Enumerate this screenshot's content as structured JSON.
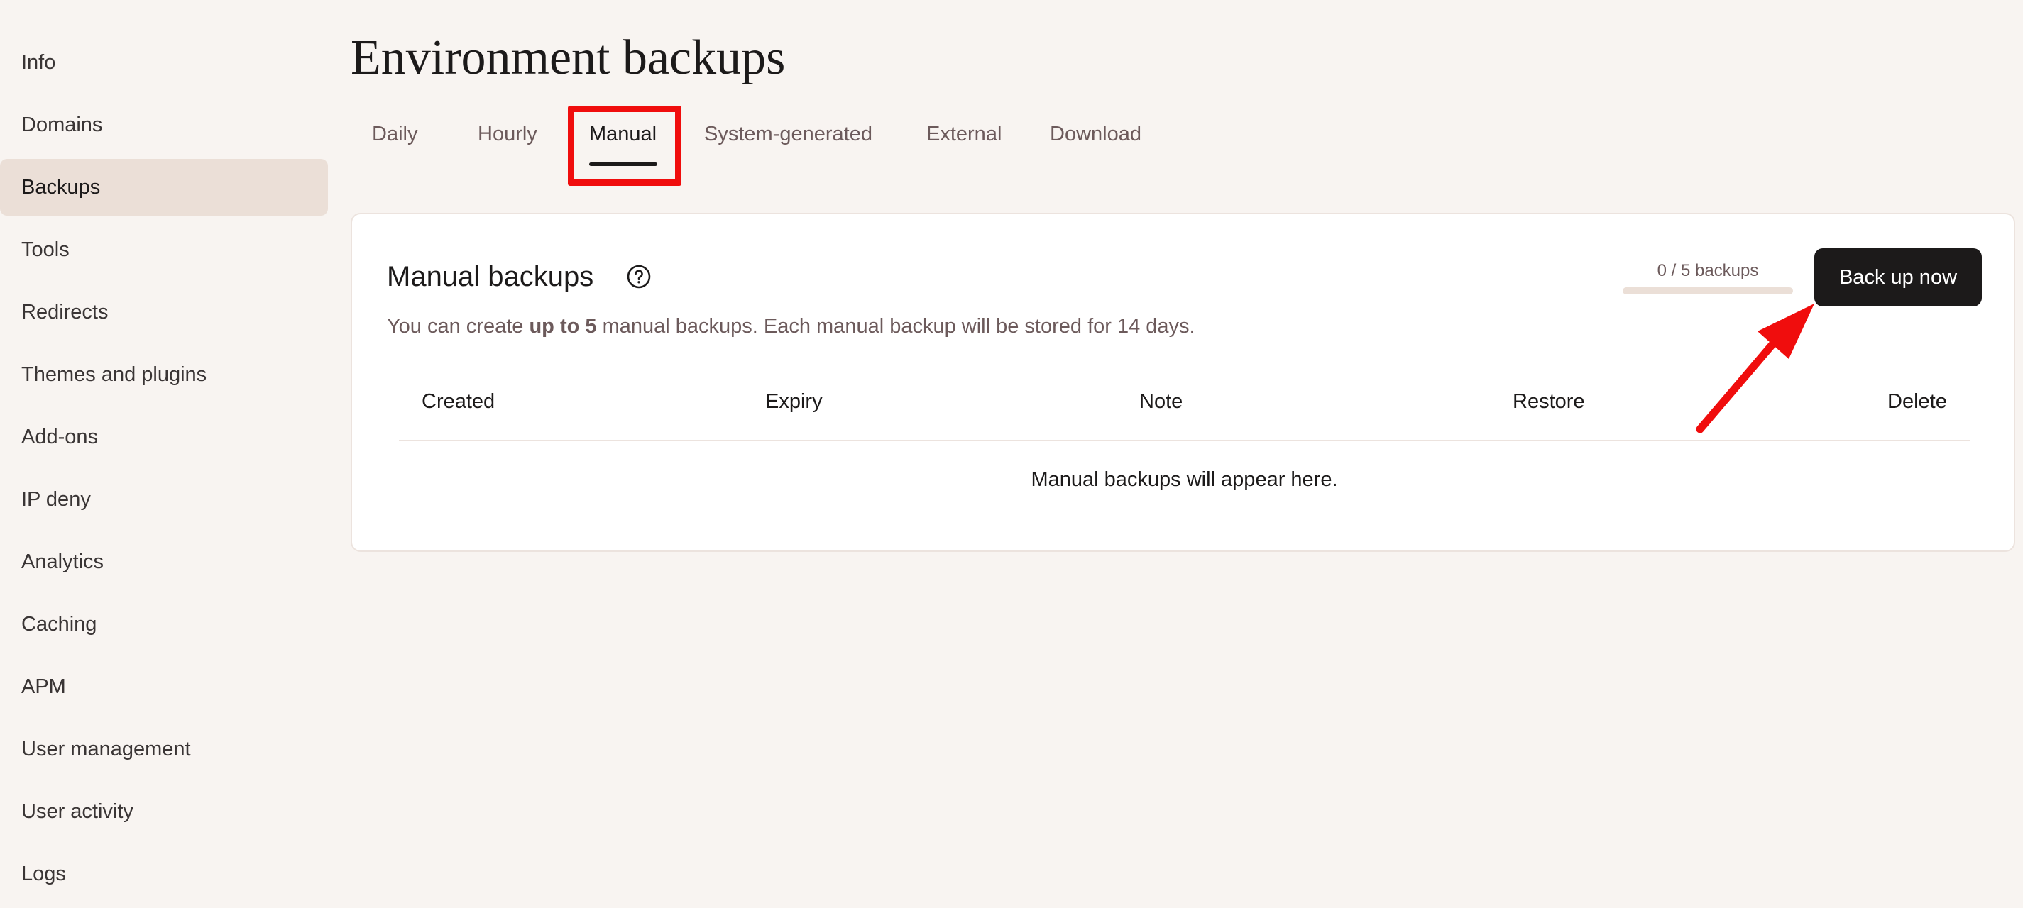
{
  "sidebar": {
    "items": [
      {
        "label": "Info"
      },
      {
        "label": "Domains"
      },
      {
        "label": "Backups",
        "active": true
      },
      {
        "label": "Tools"
      },
      {
        "label": "Redirects"
      },
      {
        "label": "Themes and plugins"
      },
      {
        "label": "Add-ons"
      },
      {
        "label": "IP deny"
      },
      {
        "label": "Analytics"
      },
      {
        "label": "Caching"
      },
      {
        "label": "APM"
      },
      {
        "label": "User management"
      },
      {
        "label": "User activity"
      },
      {
        "label": "Logs"
      }
    ]
  },
  "page": {
    "title": "Environment backups"
  },
  "tabs": [
    {
      "label": "Daily"
    },
    {
      "label": "Hourly"
    },
    {
      "label": "Manual",
      "active": true
    },
    {
      "label": "System-generated"
    },
    {
      "label": "External"
    },
    {
      "label": "Download"
    }
  ],
  "card": {
    "title": "Manual backups",
    "help_icon": "question-circle-icon",
    "description_prefix": "You can create ",
    "description_bold": "up to 5",
    "description_suffix": " manual backups. Each manual backup will be stored for 14 days.",
    "usage_text": "0 / 5 backups",
    "usage_fraction": 0,
    "primary_button": "Back up now"
  },
  "table": {
    "columns": [
      "Created",
      "Expiry",
      "Note",
      "Restore",
      "Delete"
    ],
    "empty_message": "Manual backups will appear here."
  },
  "annotations": {
    "highlight_color": "#f00d0d"
  },
  "colors": {
    "background": "#f8f4f1",
    "active_nav": "#ebdfd7",
    "muted_text": "#6c5a5b",
    "primary_button": "#1c1a1a"
  }
}
